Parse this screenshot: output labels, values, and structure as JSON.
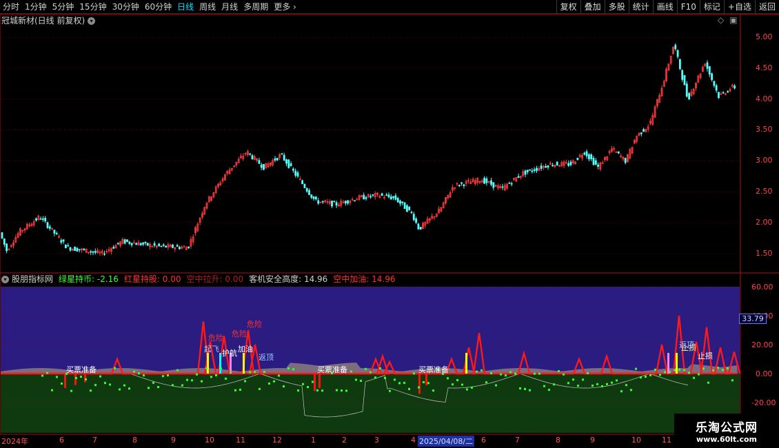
{
  "toolbar": {
    "periods": [
      "分时",
      "1分钟",
      "5分钟",
      "15分钟",
      "30分钟",
      "60分钟",
      "日线",
      "周线",
      "月线",
      "多周期",
      "更多"
    ],
    "active_period": "日线",
    "more_chevron": "›",
    "tools": [
      "复权",
      "叠加",
      "多股",
      "统计",
      "画线",
      "F10",
      "标记",
      "+自选",
      "返回"
    ]
  },
  "main_chart": {
    "title": "冠城新材(日线 前复权)",
    "price_axis": [
      "5.00",
      "4.50",
      "4.00",
      "3.50",
      "3.00",
      "2.50",
      "2.00",
      "1.50"
    ],
    "up_color": "#ff3b3b",
    "down_color": "#54ffff"
  },
  "indicator": {
    "name": "股朋指标网",
    "items": [
      {
        "label": "绿星持币: -2.16",
        "color": "#33ff33"
      },
      {
        "label": "红星持股: 0.00",
        "color": "#ff3030"
      },
      {
        "label": "空中拉升: 0.00",
        "color": "#b02020"
      },
      {
        "label": "客机安全高度: 14.96",
        "color": "#d0d0d0"
      },
      {
        "label": "空中加油: 14.96",
        "color": "#ff3030"
      }
    ],
    "axis": [
      "60.00",
      "40.00",
      "20.00",
      "0.00",
      "-20.00"
    ],
    "current_value": "33.79",
    "annotations": [
      "买票准备",
      "危险",
      "危险",
      "危险",
      "起飞",
      "护航",
      "加油",
      "返顶",
      "买票准备",
      "买票准备",
      "止损",
      "止损",
      "返顶"
    ]
  },
  "time_axis": {
    "labels": [
      "2024年",
      "6",
      "7",
      "8",
      "9",
      "10",
      "11",
      "12",
      "1",
      "2",
      "3",
      "4",
      "2025/04/08/二",
      "6",
      "7",
      "8",
      "9",
      "10",
      "11"
    ],
    "selected": "2025/04/08/二"
  },
  "watermark": {
    "title": "乐淘公式网",
    "url": "www.60lt.com"
  }
}
